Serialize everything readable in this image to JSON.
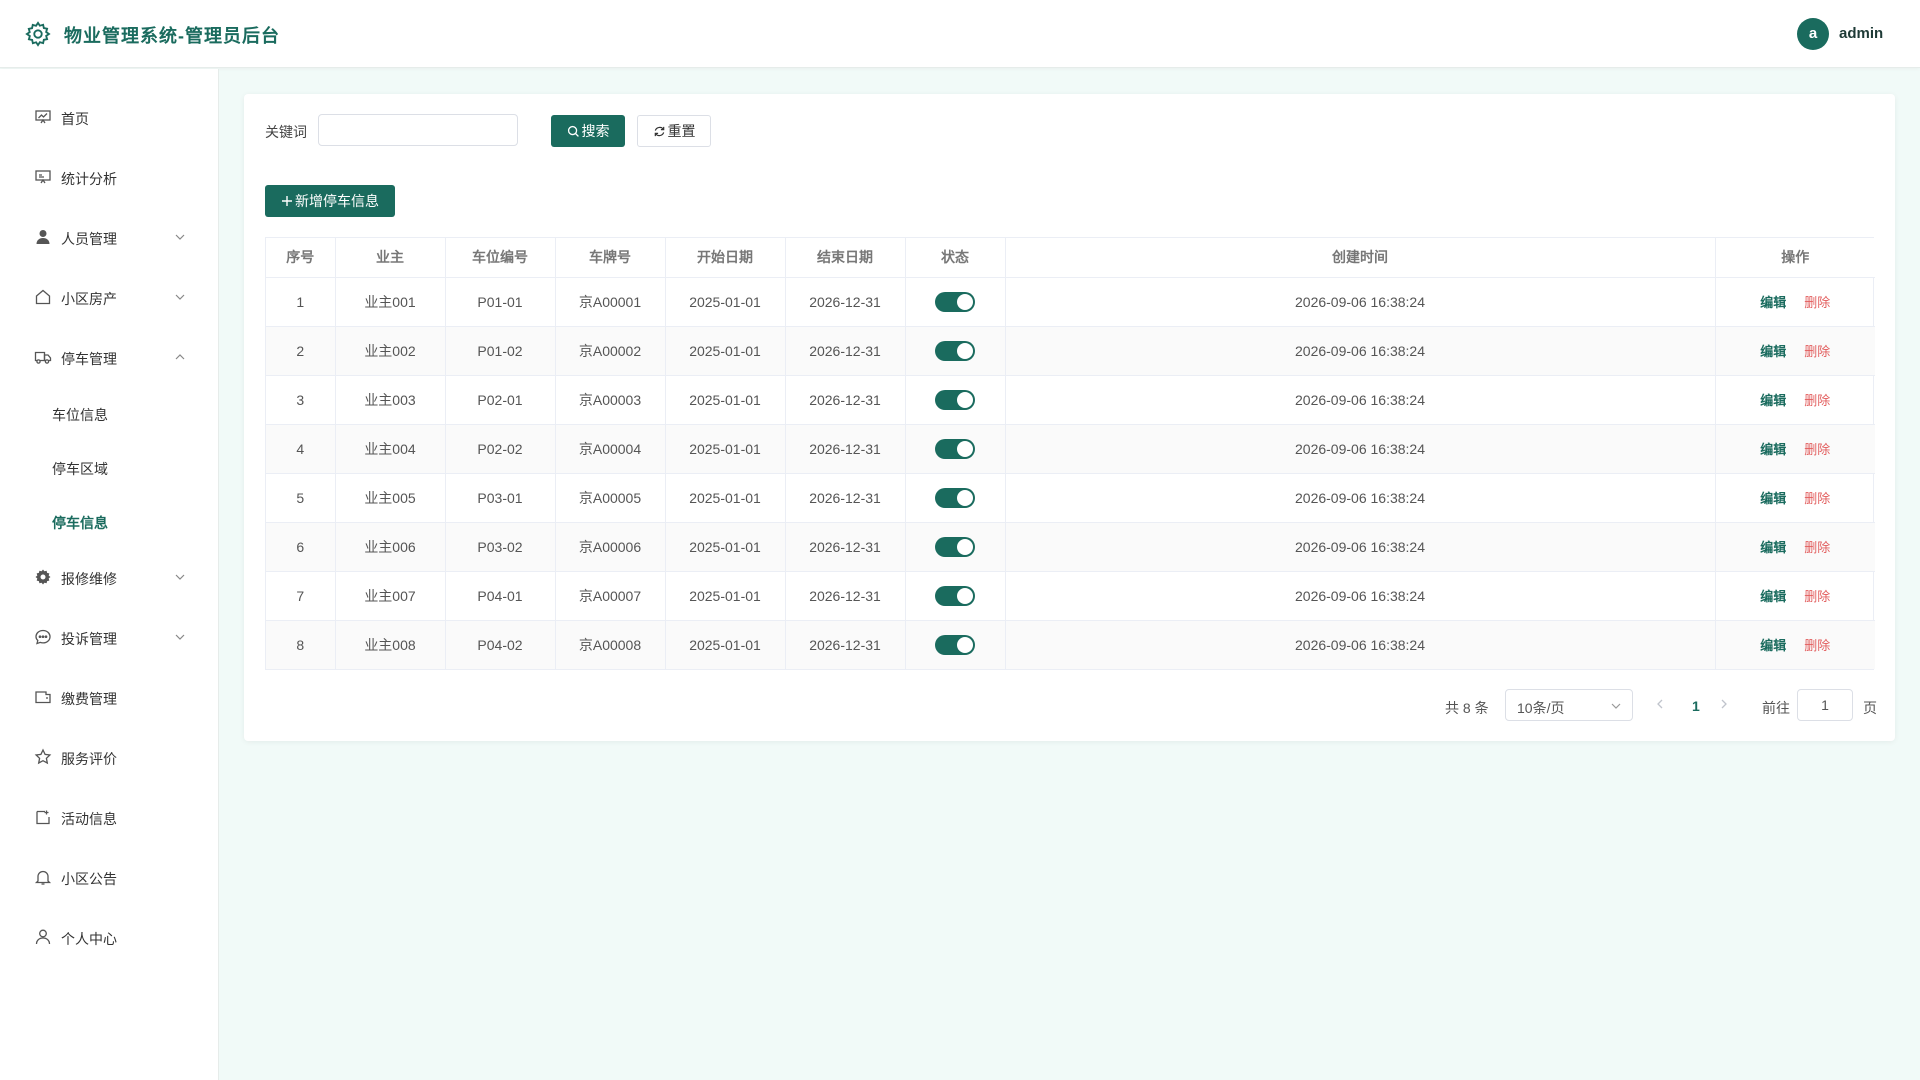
{
  "header": {
    "title": "物业管理系统-管理员后台",
    "avatar_letter": "a",
    "username": "admin"
  },
  "sidebar": {
    "items": [
      {
        "label": "首页",
        "icon": "chart-board-icon"
      },
      {
        "label": "统计分析",
        "icon": "presentation-icon"
      },
      {
        "label": "人员管理",
        "icon": "user-icon",
        "expandable": true
      },
      {
        "label": "小区房产",
        "icon": "house-icon",
        "expandable": true
      },
      {
        "label": "停车管理",
        "icon": "van-icon",
        "expandable": true,
        "expanded": true
      },
      {
        "label": "报修维修",
        "icon": "gear-icon",
        "expandable": true
      },
      {
        "label": "投诉管理",
        "icon": "chat-icon",
        "expandable": true
      },
      {
        "label": "缴费管理",
        "icon": "wallet-icon"
      },
      {
        "label": "服务评价",
        "icon": "star-icon"
      },
      {
        "label": "活动信息",
        "icon": "calendar-icon"
      },
      {
        "label": "小区公告",
        "icon": "bell-icon"
      },
      {
        "label": "个人中心",
        "icon": "user-icon"
      }
    ],
    "parking_sub": [
      {
        "label": "车位信息"
      },
      {
        "label": "停车区域"
      },
      {
        "label": "停车信息",
        "active": true
      }
    ]
  },
  "search": {
    "keyword_label": "关键词",
    "keyword_value": "",
    "search_label": "搜索",
    "reset_label": "重置",
    "add_label": "新增停车信息"
  },
  "table": {
    "columns": [
      "序号",
      "业主",
      "车位编号",
      "车牌号",
      "开始日期",
      "结束日期",
      "状态",
      "创建时间",
      "操作"
    ],
    "rows": [
      {
        "no": "1",
        "owner": "业主001",
        "space": "P01-01",
        "plate": "京A00001",
        "start": "2025-01-01",
        "end": "2026-12-31",
        "status": true,
        "created": "2026-09-06 16:38:24"
      },
      {
        "no": "2",
        "owner": "业主002",
        "space": "P01-02",
        "plate": "京A00002",
        "start": "2025-01-01",
        "end": "2026-12-31",
        "status": true,
        "created": "2026-09-06 16:38:24"
      },
      {
        "no": "3",
        "owner": "业主003",
        "space": "P02-01",
        "plate": "京A00003",
        "start": "2025-01-01",
        "end": "2026-12-31",
        "status": true,
        "created": "2026-09-06 16:38:24"
      },
      {
        "no": "4",
        "owner": "业主004",
        "space": "P02-02",
        "plate": "京A00004",
        "start": "2025-01-01",
        "end": "2026-12-31",
        "status": true,
        "created": "2026-09-06 16:38:24"
      },
      {
        "no": "5",
        "owner": "业主005",
        "space": "P03-01",
        "plate": "京A00005",
        "start": "2025-01-01",
        "end": "2026-12-31",
        "status": true,
        "created": "2026-09-06 16:38:24"
      },
      {
        "no": "6",
        "owner": "业主006",
        "space": "P03-02",
        "plate": "京A00006",
        "start": "2025-01-01",
        "end": "2026-12-31",
        "status": true,
        "created": "2026-09-06 16:38:24"
      },
      {
        "no": "7",
        "owner": "业主007",
        "space": "P04-01",
        "plate": "京A00007",
        "start": "2025-01-01",
        "end": "2026-12-31",
        "status": true,
        "created": "2026-09-06 16:38:24"
      },
      {
        "no": "8",
        "owner": "业主008",
        "space": "P04-02",
        "plate": "京A00008",
        "start": "2025-01-01",
        "end": "2026-12-31",
        "status": true,
        "created": "2026-09-06 16:38:24"
      }
    ],
    "edit_label": "编辑",
    "delete_label": "删除"
  },
  "pagination": {
    "total_text": "共 8 条",
    "page_size": "10条/页",
    "current_page": "1",
    "goto_label": "前往",
    "goto_value": "1",
    "page_suffix": "页"
  },
  "colors": {
    "primary": "#1a6b5e",
    "danger": "#e25c5c",
    "background": "#f1faf8"
  }
}
